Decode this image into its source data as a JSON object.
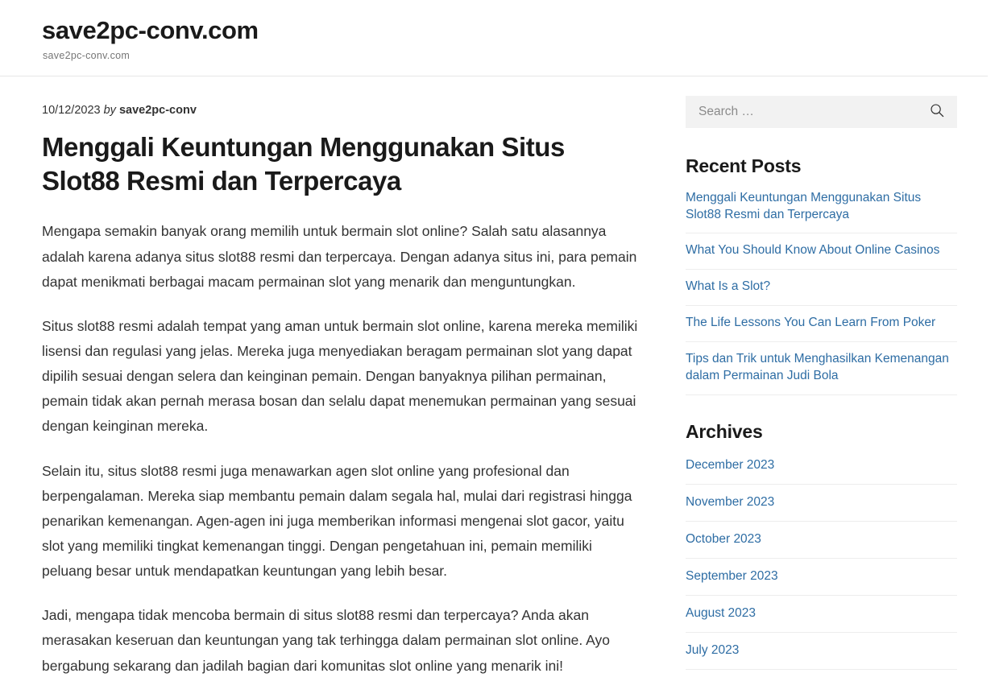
{
  "header": {
    "site_title": "save2pc-conv.com",
    "tagline": "save2pc-conv.com"
  },
  "post": {
    "date": "10/12/2023",
    "by_label": "by",
    "author": "save2pc-conv",
    "title": "Menggali Keuntungan Menggunakan Situs Slot88 Resmi dan Terpercaya",
    "paragraphs": [
      "Mengapa semakin banyak orang memilih untuk bermain slot online? Salah satu alasannya adalah karena adanya situs slot88 resmi dan terpercaya. Dengan adanya situs ini, para pemain dapat menikmati berbagai macam permainan slot yang menarik dan menguntungkan.",
      "Situs slot88 resmi adalah tempat yang aman untuk bermain slot online, karena mereka memiliki lisensi dan regulasi yang jelas. Mereka juga menyediakan beragam permainan slot yang dapat dipilih sesuai dengan selera dan keinginan pemain. Dengan banyaknya pilihan permainan, pemain tidak akan pernah merasa bosan dan selalu dapat menemukan permainan yang sesuai dengan keinginan mereka.",
      "Selain itu, situs slot88 resmi juga menawarkan agen slot online yang profesional dan berpengalaman. Mereka siap membantu pemain dalam segala hal, mulai dari registrasi hingga penarikan kemenangan. Agen-agen ini juga memberikan informasi mengenai slot gacor, yaitu slot yang memiliki tingkat kemenangan tinggi. Dengan pengetahuan ini, pemain memiliki peluang besar untuk mendapatkan keuntungan yang lebih besar.",
      "Jadi, mengapa tidak mencoba bermain di situs slot88 resmi dan terpercaya? Anda akan merasakan keseruan dan keuntungan yang tak terhingga dalam permainan slot online. Ayo bergabung sekarang dan jadilah bagian dari komunitas slot online yang menarik ini!"
    ]
  },
  "sidebar": {
    "search": {
      "placeholder": "Search …",
      "value": "",
      "icon": "search-icon"
    },
    "recent_posts": {
      "title": "Recent Posts",
      "items": [
        "Menggali Keuntungan Menggunakan Situs Slot88 Resmi dan Terpercaya",
        "What You Should Know About Online Casinos",
        "What Is a Slot?",
        "The Life Lessons You Can Learn From Poker",
        "Tips dan Trik untuk Menghasilkan Kemenangan dalam Permainan Judi Bola"
      ]
    },
    "archives": {
      "title": "Archives",
      "items": [
        "December 2023",
        "November 2023",
        "October 2023",
        "September 2023",
        "August 2023",
        "July 2023"
      ]
    }
  },
  "colors": {
    "link": "#2e6da4",
    "text": "#333333",
    "heading": "#1a1a1a",
    "muted": "#767676",
    "search_background": "#f2f2f2",
    "divider": "#ededed",
    "header_border": "#e6e6e6"
  }
}
